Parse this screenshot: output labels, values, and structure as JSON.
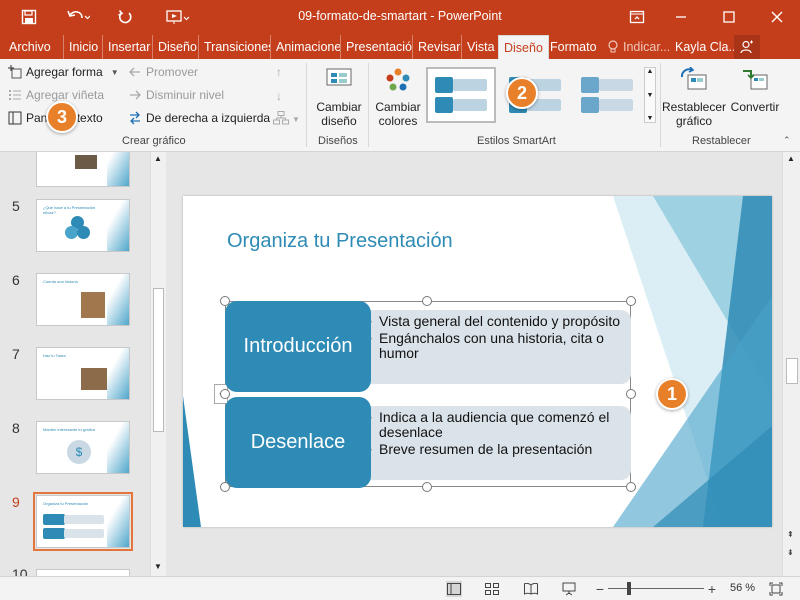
{
  "window": {
    "title": "09-formato-de-smartart - PowerPoint"
  },
  "menu": {
    "tabs": [
      "Archivo",
      "Inicio",
      "Insertar",
      "Diseño",
      "Transiciones",
      "Animaciones",
      "Presentación",
      "Revisar",
      "Vista",
      "Diseño",
      "Formato"
    ],
    "active_index": 9,
    "tell_me": "Indicar...",
    "user": "Kayla Cla..."
  },
  "ribbon": {
    "crear_grafico": {
      "label": "Crear gráfico",
      "agregar_forma": "Agregar forma",
      "agregar_vineta": "Agregar viñeta",
      "panel_texto": "Panel de texto",
      "promover": "Promover",
      "disminuir_nivel": "Disminuir nivel",
      "derecha_izquierda": "De derecha a izquierda"
    },
    "disenos": {
      "label": "Diseños",
      "cambiar_diseno": "Cambiar\ndiseño"
    },
    "estilos": {
      "label": "Estilos SmartArt",
      "cambiar_colores": "Cambiar\ncolores"
    },
    "restablecer": {
      "label": "Restablecer",
      "restablecer_grafico": "Restablecer\ngráfico",
      "convertir": "Convertir"
    }
  },
  "badges": [
    "1",
    "2",
    "3"
  ],
  "thumbnails": [
    {
      "num": "",
      "title": ""
    },
    {
      "num": "5",
      "title": "¿Qué hace a tu Presentación eficaz?"
    },
    {
      "num": "6",
      "title": "Cuenta una historia"
    },
    {
      "num": "7",
      "title": "Haz tu Tarea"
    },
    {
      "num": "8",
      "title": "Mantén interesante tu gráfica"
    },
    {
      "num": "9",
      "title": "Organiza tu Presentación"
    },
    {
      "num": "10",
      "title": ""
    }
  ],
  "slide": {
    "title": "Organiza tu Presentación",
    "rows": [
      {
        "heading": "Introducción",
        "bullets": [
          "Vista general del contenido y propósito",
          "Engánchalos con una historia, cita o humor"
        ]
      },
      {
        "heading": "Desenlace",
        "bullets": [
          "Indica a la audiencia que comenzó el desenlace",
          "Breve resumen de la presentación"
        ]
      }
    ]
  },
  "status": {
    "zoom": "56 %"
  },
  "colors": {
    "accent": "#c43e1c",
    "smartart": "#2e8bb5",
    "badge": "#e8802a"
  }
}
